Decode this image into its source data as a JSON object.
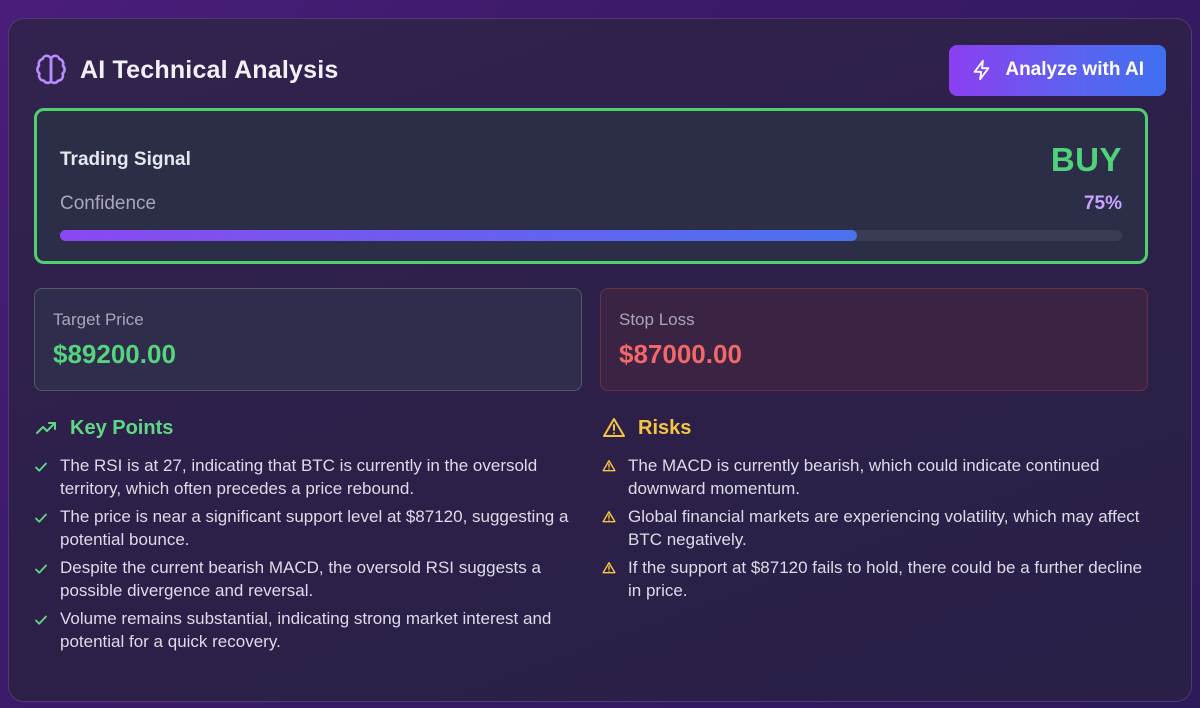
{
  "header": {
    "title": "AI Technical Analysis",
    "analyze_button": "Analyze with AI"
  },
  "signal": {
    "label": "Trading Signal",
    "value": "BUY",
    "confidence_label": "Confidence",
    "confidence_value": "75%",
    "confidence": 0.75
  },
  "target": {
    "label": "Target Price",
    "value": "$89200.00"
  },
  "stop_loss": {
    "label": "Stop Loss",
    "value": "$87000.00"
  },
  "key_points": {
    "title": "Key Points",
    "items": [
      "The RSI is at 27, indicating that BTC is currently in the oversold territory, which often precedes a price rebound.",
      "The price is near a significant support level at $87120, suggesting a potential bounce.",
      "Despite the current bearish MACD, the oversold RSI suggests a possible divergence and reversal.",
      "Volume remains substantial, indicating strong market interest and potential for a quick recovery."
    ]
  },
  "risks": {
    "title": "Risks",
    "items": [
      "The MACD is currently bearish, which could indicate continued downward momentum.",
      "Global financial markets are experiencing volatility, which may affect BTC negatively.",
      "If the support at $87120 fails to hold, there could be a further decline in price."
    ]
  },
  "colors": {
    "buy": "#4fd27a",
    "accent_purple": "#8b3ff0",
    "accent_blue": "#3f6ff0",
    "stop_loss": "#f26868",
    "warning": "#f4c542"
  },
  "icons": {
    "header": "brain-icon",
    "button": "bolt-icon",
    "key_points": "trending-up-icon",
    "risks": "warning-triangle-icon",
    "key_point_item": "check-icon",
    "risk_item": "warning-triangle-icon"
  }
}
